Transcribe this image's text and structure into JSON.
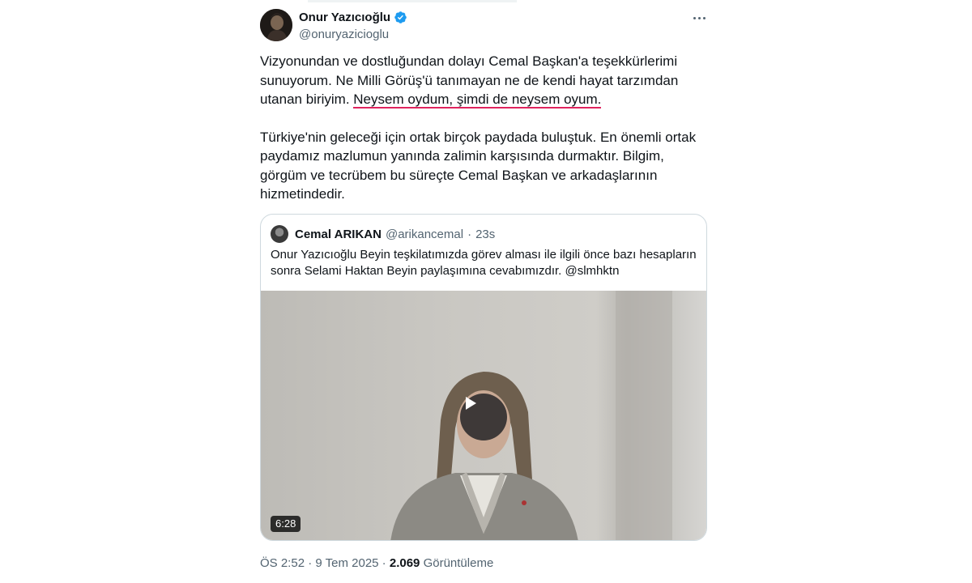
{
  "author": {
    "display_name": "Onur Yazıcıoğlu",
    "handle": "@onuryazicioglu",
    "verified": true
  },
  "tweet": {
    "para1_before": "Vizyonundan ve dostluğundan dolayı Cemal Başkan'a teşekkürlerimi sunuyorum. Ne Milli Görüş'ü tanımayan ne de kendi hayat tarzımdan utanan biriyim. ",
    "para1_highlight": "Neysem oydum, şimdi de neysem oyum.",
    "para2": "Türkiye'nin geleceği için ortak birçok paydada buluştuk. En önemli ortak paydamız mazlumun yanında zalimin karşısında durmaktır. Bilgim, görgüm ve tecrübem bu süreçte Cemal Başkan ve arkadaşlarının hizmetindedir."
  },
  "quote": {
    "display_name": "Cemal ARIKAN",
    "handle": "@arikancemal",
    "separator": "·",
    "time": "23s",
    "text": "Onur Yazıcıoğlu Beyin teşkilatımızda görev alması ile ilgili önce bazı hesapların sonra Selami Haktan Beyin paylaşımına cevabımızdır. @slmhktn",
    "video_duration": "6:28"
  },
  "meta": {
    "time": "ÖS 2:52",
    "separator": " · ",
    "date": "9 Tem 2025",
    "views_count": "2.069",
    "views_label": "Görüntüleme"
  },
  "colors": {
    "accent_blue": "#1d9bf0",
    "highlight_underline": "#e0245e",
    "secondary_text": "#536471"
  },
  "icons": [
    "verified-badge-icon",
    "more-options-icon",
    "play-icon"
  ]
}
